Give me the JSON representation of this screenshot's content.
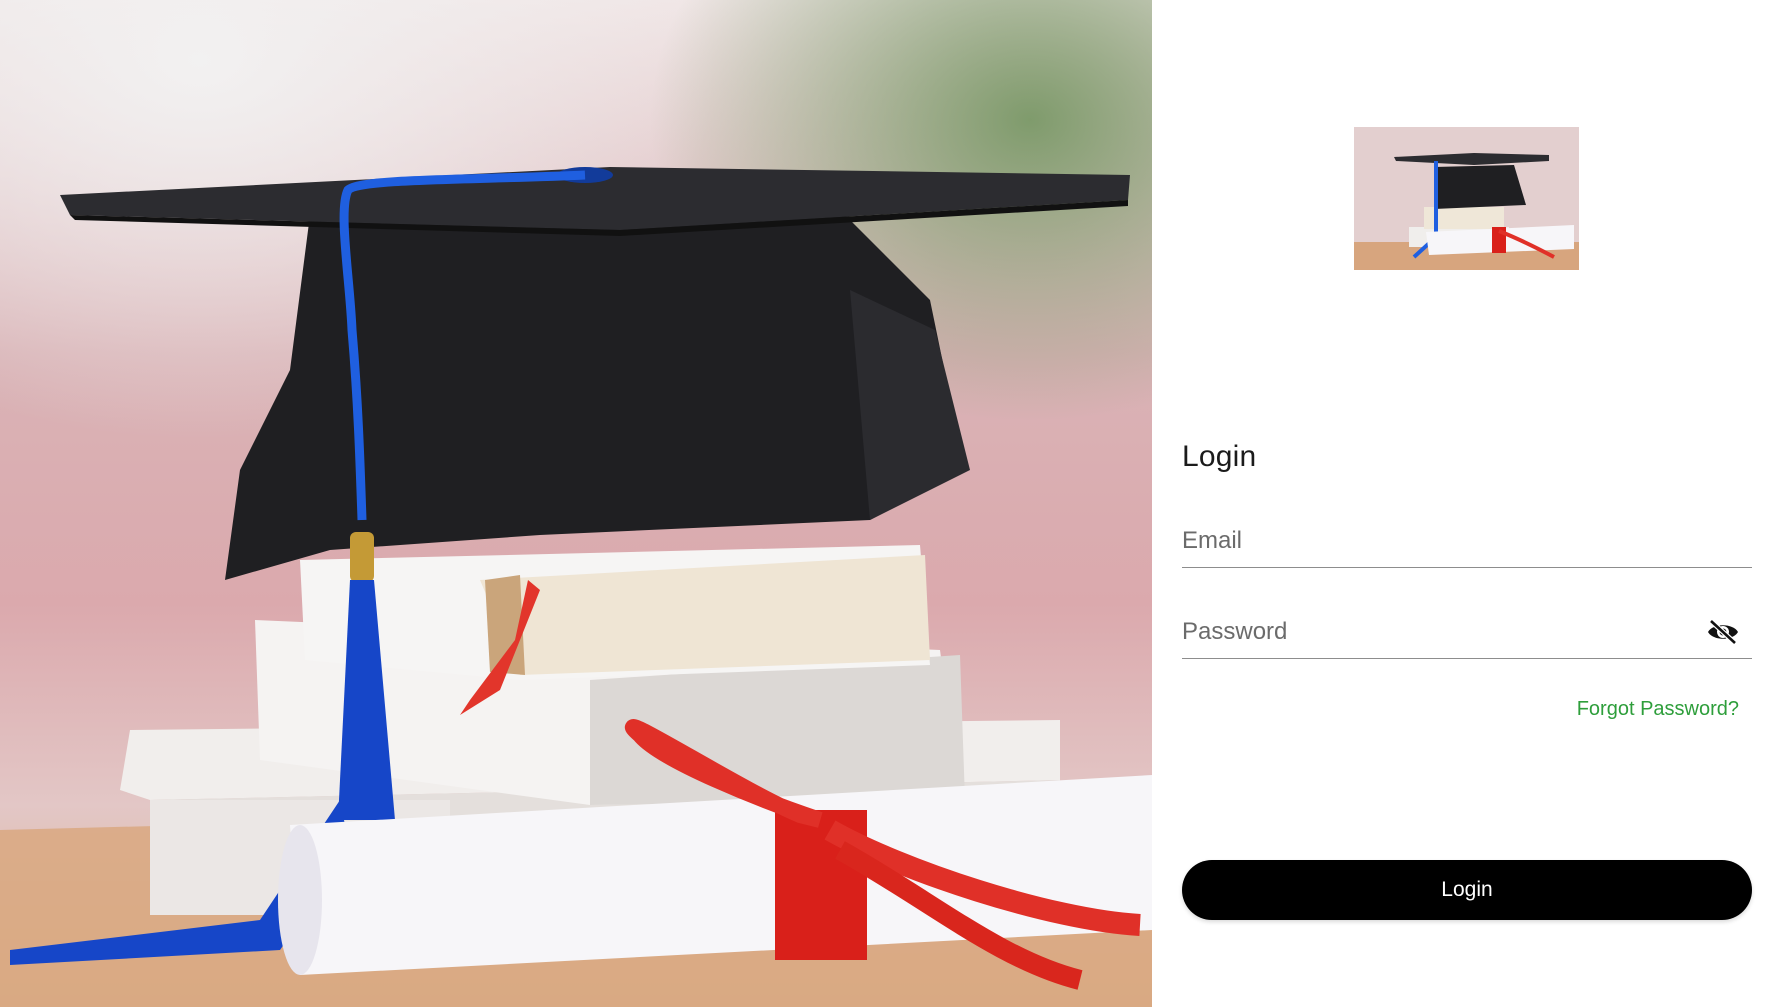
{
  "hero": {
    "image_subject": "graduation cap, books and diploma scroll"
  },
  "logo": {
    "image_subject": "graduation cap, books and diploma scroll"
  },
  "login_form": {
    "title": "Login",
    "email": {
      "placeholder": "Email",
      "value": ""
    },
    "password": {
      "placeholder": "Password",
      "value": "",
      "visibility_icon": "eye-off-icon"
    },
    "forgot_password_label": "Forgot Password?",
    "submit_label": "Login"
  },
  "colors": {
    "accent_link": "#2e9e3b",
    "button_bg": "#000000",
    "button_text": "#ffffff"
  }
}
